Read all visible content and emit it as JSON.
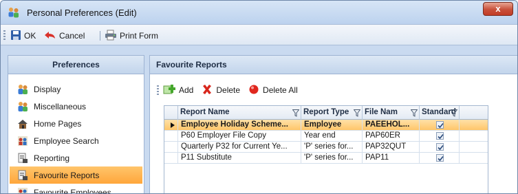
{
  "window": {
    "title": "Personal Preferences (Edit)",
    "close_glyph": "x"
  },
  "toolbar": {
    "ok_label": "OK",
    "cancel_label": "Cancel",
    "print_label": "Print Form"
  },
  "preferences": {
    "header": "Preferences",
    "items": [
      {
        "label": "Display",
        "icon": "display-icon"
      },
      {
        "label": "Miscellaneous",
        "icon": "miscellaneous-icon"
      },
      {
        "label": "Home Pages",
        "icon": "home-icon"
      },
      {
        "label": "Employee Search",
        "icon": "employee-search-icon"
      },
      {
        "label": "Reporting",
        "icon": "reporting-icon"
      },
      {
        "label": "Favourite Reports",
        "icon": "favourite-reports-icon",
        "active": true
      },
      {
        "label": "Favourite Employees",
        "icon": "favourite-employees-icon"
      }
    ]
  },
  "favourites": {
    "header": "Favourite Reports",
    "add_label": "Add",
    "delete_label": "Delete",
    "delete_all_label": "Delete All",
    "columns": [
      "Report Name",
      "Report Type",
      "File Nam",
      "Standard"
    ],
    "rows": [
      {
        "name": "Employee Holiday Scheme...",
        "type": "Employee",
        "file": "PAEEHOL...",
        "standard": true,
        "selected": true
      },
      {
        "name": "P60 Employer File Copy",
        "type": "Year end",
        "file": "PAP60ER",
        "standard": true,
        "selected": false
      },
      {
        "name": "Quarterly P32 for Current Ye...",
        "type": "'P' series for...",
        "file": "PAP32QUT",
        "standard": true,
        "selected": false
      },
      {
        "name": "P11 Substitute",
        "type": "'P' series for...",
        "file": "PAP11",
        "standard": true,
        "selected": false
      }
    ]
  },
  "colors": {
    "active_item": "#ffa63b",
    "selected_row": "#ffc66a",
    "panel_border": "#9db3d3"
  }
}
